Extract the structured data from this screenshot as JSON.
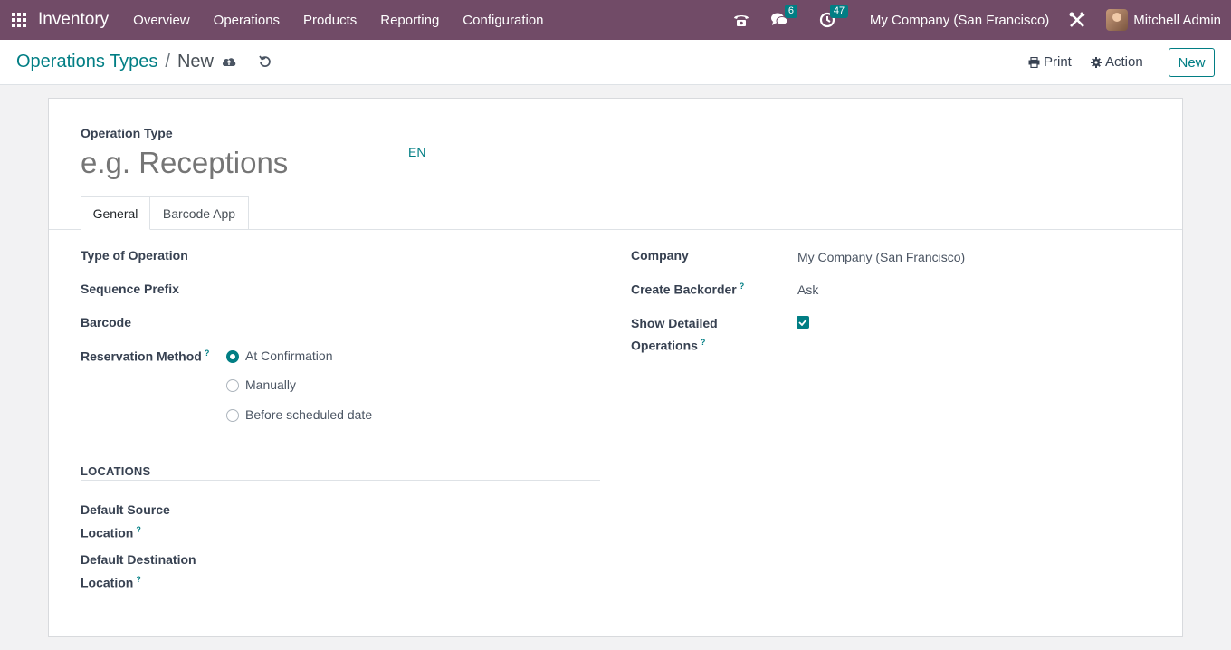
{
  "navbar": {
    "app_name": "Inventory",
    "menu": [
      "Overview",
      "Operations",
      "Products",
      "Reporting",
      "Configuration"
    ],
    "messages_count": "6",
    "activities_count": "47",
    "company": "My Company (San Francisco)",
    "user": "Mitchell Admin",
    "brand_color": "#714b67"
  },
  "control_panel": {
    "breadcrumb_parent": "Operations Types",
    "breadcrumb_separator": "/",
    "breadcrumb_current": "New",
    "print_label": "Print",
    "action_label": "Action",
    "new_label": "New"
  },
  "form": {
    "name_label": "Operation Type",
    "name_placeholder": "e.g. Receptions",
    "lang_label": "EN",
    "tabs": [
      "General",
      "Barcode App"
    ],
    "fields_left": {
      "type_of_operation": "Type of Operation",
      "sequence_prefix": "Sequence Prefix",
      "barcode": "Barcode",
      "reservation_method": "Reservation Method"
    },
    "help_mark": "?",
    "reservation_options": [
      "At Confirmation",
      "Manually",
      "Before scheduled date"
    ],
    "reservation_selected": "At Confirmation",
    "locations_title": "LOCATIONS",
    "default_source_line1": "Default Source",
    "default_source_line2": "Location",
    "default_destination_line1": "Default Destination",
    "default_destination_line2": "Location",
    "fields_right": {
      "company_label": "Company",
      "company_value": "My Company (San Francisco)",
      "create_backorder_label": "Create Backorder",
      "create_backorder_value": "Ask",
      "show_detailed_line1": "Show Detailed",
      "show_detailed_line2": "Operations",
      "show_detailed_checked": true
    },
    "accent_color": "#017e84"
  }
}
